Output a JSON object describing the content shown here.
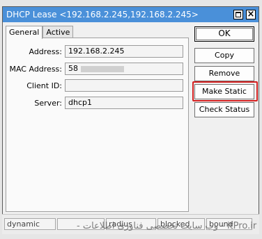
{
  "window": {
    "title": "DHCP Lease <192.168.2.245,192.168.2.245>",
    "maximize_icon": "maximize-icon",
    "close_icon": "close-icon"
  },
  "tabs": [
    {
      "label": "General",
      "active": true
    },
    {
      "label": "Active",
      "active": false
    }
  ],
  "fields": {
    "address": {
      "label": "Address:",
      "value": "192.168.2.245"
    },
    "mac": {
      "label": "MAC Address:",
      "value": "58"
    },
    "client_id": {
      "label": "Client ID:",
      "value": ""
    },
    "server": {
      "label": "Server:",
      "value": "dhcp1"
    }
  },
  "buttons": {
    "ok": "OK",
    "copy": "Copy",
    "remove": "Remove",
    "make_static": "Make Static",
    "check_status": "Check Status"
  },
  "statusbar": {
    "cells": [
      "dynamic",
      "",
      "radius",
      "blocked",
      "bound"
    ]
  },
  "watermark": "- وب سایت تخصصی فناوری اطلاعات - itPro.ir"
}
